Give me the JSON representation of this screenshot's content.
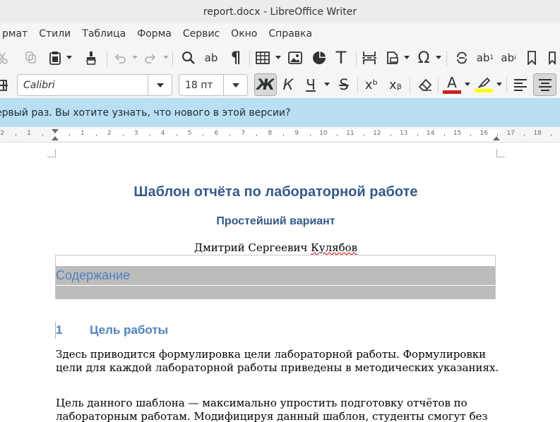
{
  "window": {
    "title": "report.docx - LibreOffice Writer"
  },
  "menubar": {
    "items": [
      "рмат",
      "Стили",
      "Таблица",
      "Форма",
      "Сервис",
      "Окно",
      "Справка"
    ]
  },
  "toolbar": {
    "font_name": "Calibri",
    "font_size": "18 пт",
    "icons": {
      "cut": "scissors-icon",
      "copy": "copy-icon",
      "paste": "clipboard-icon",
      "clone_format": "paintbrush-icon",
      "undo": "undo-icon",
      "redo": "redo-icon",
      "find": "search-icon",
      "spelling": "spellcheck-icon",
      "formatting_marks": "pilcrow-icon",
      "table": "table-icon",
      "image": "image-icon",
      "chart": "chart-icon",
      "text_box": "text-icon",
      "page_break": "page-break-icon",
      "field": "field-icon",
      "special_char": "omega-icon",
      "hyperlink": "link-icon",
      "footnote": "footnote-icon",
      "endnote": "endnote-icon",
      "bookmark": "bookmark-icon",
      "bold": "bold-icon",
      "italic": "italic-icon",
      "underline": "underline-icon",
      "strikethrough": "strikethrough-icon",
      "superscript": "superscript-icon",
      "subscript": "subscript-icon",
      "clear_format": "eraser-icon",
      "font_color": "font-color-icon",
      "highlight": "highlighter-icon",
      "align_left": "align-left-icon",
      "align_center": "align-center-icon"
    },
    "bold_glyph": "Ж",
    "italic_glyph": "К",
    "underline_glyph": "Ч",
    "strike_glyph": "S",
    "super_glyph": "xᵇ",
    "sub_glyph": "xᵦ",
    "text_glyph": "T",
    "omega_glyph": "Ω",
    "pilcrow_glyph": "¶",
    "abc_glyph": "ab",
    "fontcolor_glyph": "A",
    "colors": {
      "font_color": "#c9211e",
      "highlight": "#ffff00"
    }
  },
  "infobar": {
    "message": "ервый раз. Вы хотите узнать, что нового в этой версии?"
  },
  "ruler": {
    "labels": [
      "2",
      "1",
      "1",
      "2",
      "3",
      "4",
      "5",
      "6",
      "7",
      "8",
      "9",
      "10",
      "11",
      "12",
      "13",
      "14",
      "15",
      "16",
      "17",
      "18"
    ]
  },
  "document": {
    "title": "Шаблон отчёта по лабораторной работе",
    "subtitle": "Простейший вариант",
    "author_first": "Дмитрий Сергеевич ",
    "author_last": "Кулябов",
    "toc_heading": "Содержание",
    "section1_number": "1",
    "section1_title": "Цель работы",
    "para1": "Здесь приводится формулировка цели лабораторной работы. Формулировки цели для каждой лабораторной работы приведены в методических указаниях.",
    "para2": "Цель данного шаблона — максимально упростить подготовку отчётов по лабораторным работам. Модифицируя данный шаблон, студенты смогут без"
  }
}
